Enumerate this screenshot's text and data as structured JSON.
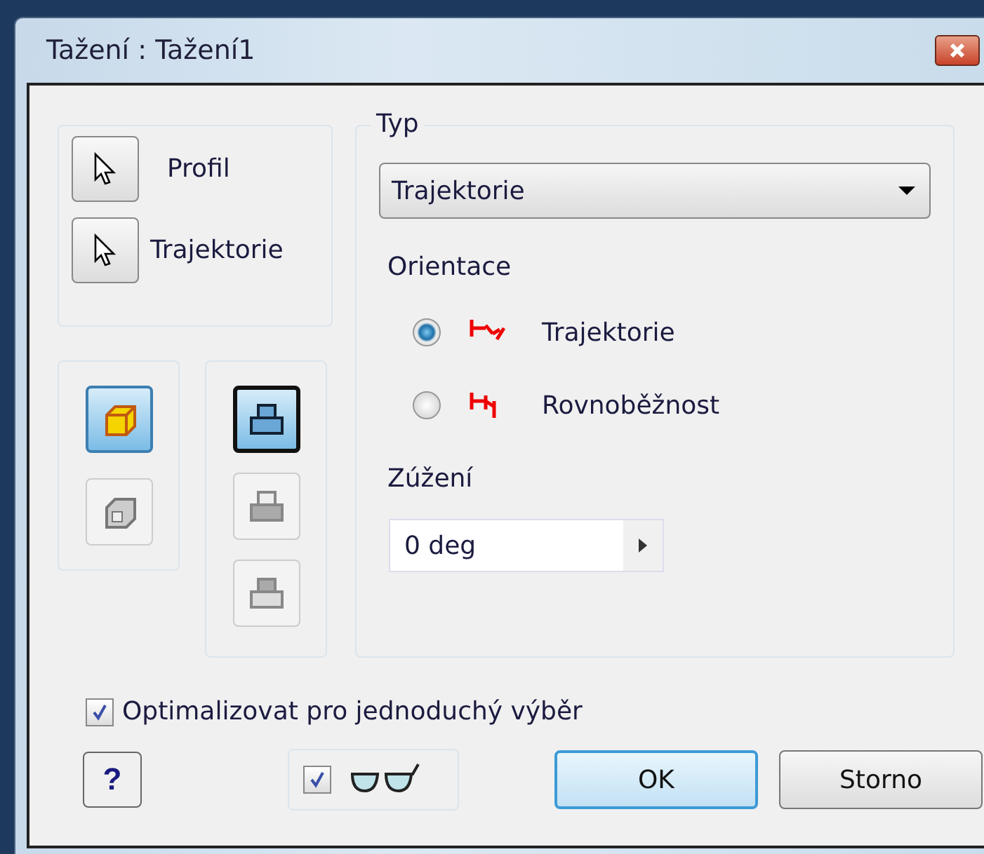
{
  "window": {
    "title": "Tažení : Tažení1"
  },
  "selection": [
    {
      "kind": "profile",
      "label": "Profil"
    },
    {
      "kind": "path",
      "label": "Trajektorie"
    }
  ],
  "outputs": [
    {
      "kind": "solid",
      "selected": true
    },
    {
      "kind": "surface",
      "selected": false
    }
  ],
  "operations": [
    {
      "kind": "join",
      "selected": true
    },
    {
      "kind": "cut",
      "selected": false
    },
    {
      "kind": "intersect",
      "selected": false
    }
  ],
  "type_group": {
    "legend": "Typ",
    "dropdown": {
      "value": "Trajektorie"
    }
  },
  "orientation": {
    "label": "Orientace",
    "options": [
      {
        "kind": "path",
        "label": "Trajektorie",
        "selected": true
      },
      {
        "kind": "parallel",
        "label": "Rovnoběžnost",
        "selected": false
      }
    ]
  },
  "taper": {
    "label": "Zúžení",
    "value": "0 deg"
  },
  "optimize": {
    "label": "Optimalizovat pro jednoduchý výběr",
    "checked": true
  },
  "preview": {
    "checked": true
  },
  "help": {
    "label": "?"
  },
  "buttons": [
    {
      "label": "OK",
      "default": true
    },
    {
      "label": "Storno",
      "default": false
    }
  ]
}
